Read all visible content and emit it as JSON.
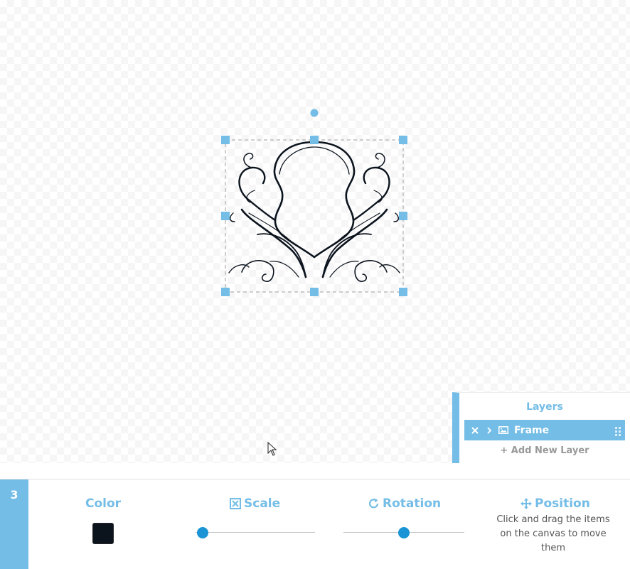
{
  "colors": {
    "accent": "#74bde6",
    "slider_knob": "#1a94d4",
    "selected_color": "#0b131d",
    "ink": "#0b131d"
  },
  "canvas": {
    "selected_item_icon": "ornamental-frame"
  },
  "layers": {
    "title": "Layers",
    "items": [
      {
        "name": "Frame",
        "icons": [
          "close-icon",
          "chevron-right-icon",
          "image-icon",
          "drag-handle-icon"
        ],
        "selected": true
      }
    ],
    "add_label": "+ Add New Layer"
  },
  "toolbar": {
    "step_number": "3",
    "color": {
      "label": "Color",
      "value": "#0b131d"
    },
    "scale": {
      "label": "Scale",
      "icon": "expand-icon",
      "level": 0.06
    },
    "rotation": {
      "label": "Rotation",
      "icon": "rotate-icon",
      "level": 0.5
    },
    "position": {
      "label": "Position",
      "icon": "move-icon",
      "help": "Click and drag the items on the canvas to move them"
    }
  }
}
